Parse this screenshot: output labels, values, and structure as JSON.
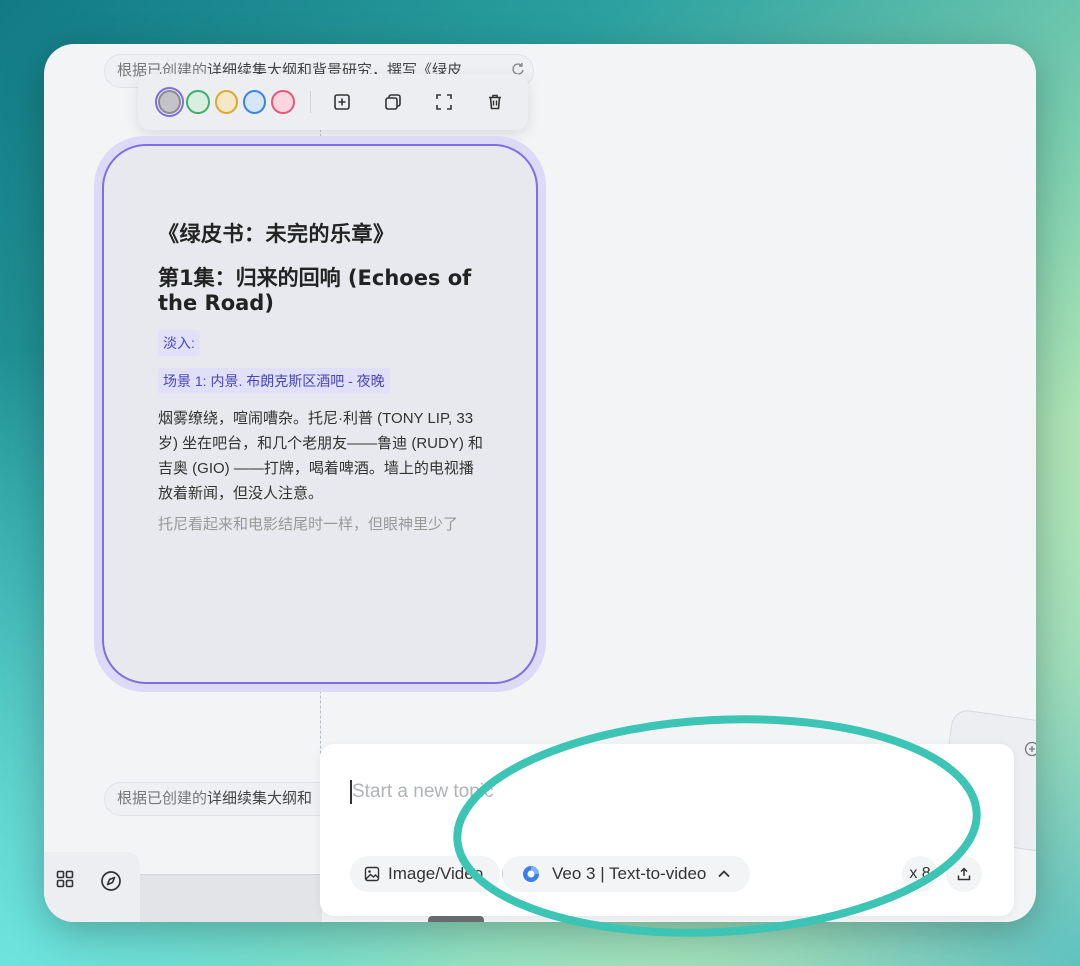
{
  "canvas": {
    "node_prompt_top": {
      "light": "根据已创建的",
      "dark": "详细续集大纲和背景研究，撰写《绿皮"
    },
    "node_prompt_bottom": {
      "light": "根据已创建的",
      "dark": "详细续集大纲和"
    }
  },
  "toolbar": {
    "swatches": [
      {
        "name": "gray",
        "fill": "#c4c4c8",
        "border": "#8a8a90"
      },
      {
        "name": "green",
        "fill": "#d8efdf",
        "border": "#3fae6b"
      },
      {
        "name": "yellow",
        "fill": "#f5e8c6",
        "border": "#d7a92e"
      },
      {
        "name": "blue",
        "fill": "#d5e6fb",
        "border": "#3a82e8"
      },
      {
        "name": "pink",
        "fill": "#fbd6e1",
        "border": "#e5557f"
      }
    ],
    "icons": [
      "add-frame-icon",
      "duplicate-icon",
      "expand-icon",
      "trash-icon"
    ]
  },
  "card": {
    "title": "《绿皮书：未完的乐章》",
    "episode": "第1集：归来的回响 (Echoes of the Road)",
    "fade_in": "淡入:",
    "scene": "场景 1: 内景. 布朗克斯区酒吧 - 夜晚",
    "paragraph": "烟雾缭绕，喧闹嘈杂。托尼·利普 (TONY LIP, 33岁) 坐在吧台，和几个老朋友——鲁迪 (RUDY) 和吉奥 (GIO) ——打牌，喝着啤酒。墙上的电视播放着新闻，但没人注意。",
    "paragraph_fade": "托尼看起来和电影结尾时一样，但眼神里少了"
  },
  "composer": {
    "placeholder": "Start a new topic",
    "image_chip": "Image/Video",
    "model_chip": "Veo 3 | Text-to-video",
    "count": "x 8"
  },
  "colors": {
    "accent": "#7c6fe3",
    "highlight_ring": "#3cc4b4"
  }
}
